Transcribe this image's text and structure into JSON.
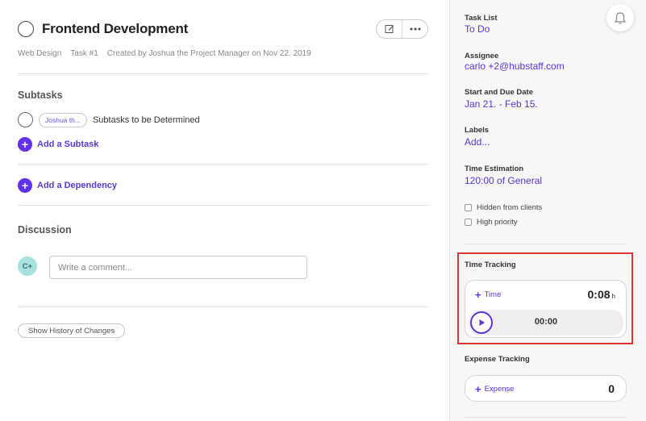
{
  "task": {
    "title": "Frontend Development",
    "meta": {
      "project": "Web Design",
      "task_number": "Task #1",
      "created_by": "Created by Joshua the Project Manager on Nov 22. 2019"
    },
    "actions": {
      "edit_icon": "edit-icon",
      "more_icon": "more-icon"
    }
  },
  "subtasks": {
    "heading": "Subtasks",
    "items": [
      {
        "assignee_chip": "Joshua th...",
        "text": "Subtasks to be Determined"
      }
    ],
    "add_label": "Add a Subtask"
  },
  "dependency": {
    "add_label": "Add a Dependency"
  },
  "discussion": {
    "heading": "Discussion",
    "avatar_initials": "C+",
    "comment_placeholder": "Write a comment..."
  },
  "history_button": "Show History of Changes",
  "sidebar": {
    "task_list": {
      "label": "Task List",
      "value": "To Do"
    },
    "assignee": {
      "label": "Assignee",
      "value": "carlo +2@hubstaff.com"
    },
    "dates": {
      "label": "Start and Due Date",
      "value": "Jan 21. - Feb 15."
    },
    "labels": {
      "label": "Labels",
      "value": "Add..."
    },
    "estimation": {
      "label": "Time Estimation",
      "value": "120:00 of General"
    },
    "checkboxes": [
      {
        "label": "Hidden from clients",
        "checked": false
      },
      {
        "label": "High priority",
        "checked": false
      }
    ],
    "time_tracking": {
      "label": "Time Tracking",
      "add_label": "Time",
      "hours": "0:08",
      "hours_unit": "h",
      "timer": "00:00"
    },
    "expense_tracking": {
      "label": "Expense Tracking",
      "add_label": "Expense",
      "value": "0"
    }
  },
  "colors": {
    "accent": "#5b34d6",
    "highlight_border": "#d93636",
    "avatar_bg": "#a8e2de"
  }
}
